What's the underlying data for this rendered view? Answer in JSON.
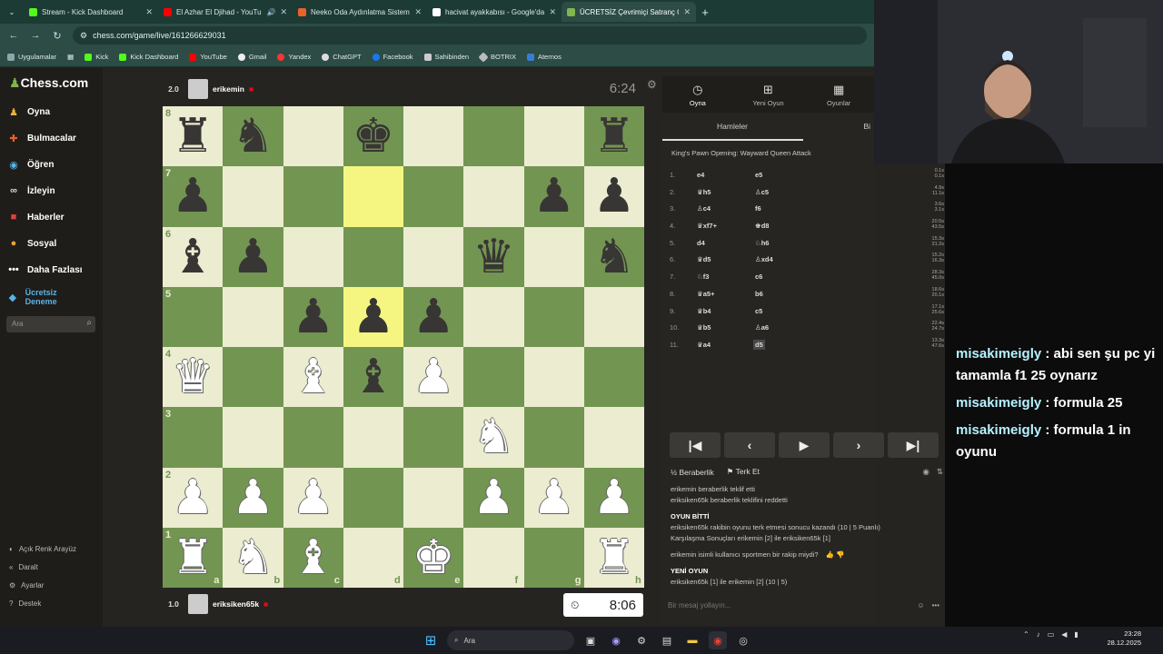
{
  "browser": {
    "tabs": [
      {
        "title": "Stream - Kick Dashboard",
        "color": "#53fc18"
      },
      {
        "title": "El Azhar El Djihad - YouTube",
        "color": "#ff0000"
      },
      {
        "title": "Neeko Oda Aydınlatma Sistem",
        "color": "#e8632b"
      },
      {
        "title": "hacivat ayakkabısı - Google'da",
        "color": "#ffffff"
      },
      {
        "title": "ÜCRETSİZ Çevrimiçi Satranç Oy",
        "color": "#81b64c"
      }
    ],
    "url": "chess.com/game/live/161266629031",
    "bookmarks": [
      "Uygulamalar",
      "Kick",
      "Kick Dashboard",
      "YouTube",
      "Gmail",
      "Yandex",
      "ChatGPT",
      "Facebook",
      "Sahibinden",
      "BOTRIX",
      "Aternos"
    ]
  },
  "sidebar": {
    "logo": "Chess.com",
    "items": [
      "Oyna",
      "Bulmacalar",
      "Öğren",
      "İzleyin",
      "Haberler",
      "Sosyal",
      "Daha Fazlası"
    ],
    "promo": "Ücretsiz Deneme",
    "search_placeholder": "Ara",
    "footer": [
      "Açık Renk Arayüz",
      "Daralt",
      "Ayarlar",
      "Destek"
    ]
  },
  "game": {
    "top_player": {
      "name": "erikemin",
      "score": "2.0",
      "clock": "6:24"
    },
    "bottom_player": {
      "name": "eriksiken65k",
      "score": "1.0",
      "clock": "8:06"
    },
    "board": [
      [
        "r",
        "n",
        "",
        "k",
        "",
        "",
        "",
        "r"
      ],
      [
        "p",
        "",
        "",
        "",
        "",
        "",
        "p",
        "p"
      ],
      [
        "b",
        "p",
        "",
        "",
        "",
        "q",
        "",
        "n"
      ],
      [
        "",
        "",
        "p",
        "p",
        "p",
        "",
        "",
        ""
      ],
      [
        "Q",
        "",
        "B",
        "b",
        "P",
        "",
        "",
        ""
      ],
      [
        "",
        "",
        "",
        "",
        "",
        "N",
        "",
        ""
      ],
      [
        "P",
        "P",
        "P",
        "",
        "",
        "P",
        "P",
        "P"
      ],
      [
        "R",
        "N",
        "B",
        "",
        "K",
        "",
        "",
        "R"
      ]
    ],
    "highlights": [
      "d7",
      "d5"
    ]
  },
  "panel": {
    "tabs": [
      "Oyna",
      "Yeni Oyun",
      "Oyunlar"
    ],
    "moves_tab": "Hamleler",
    "moves_tab2": "Bi",
    "opening": "King's Pawn Opening: Wayward Queen Attack",
    "moves": [
      {
        "n": "1.",
        "w": "e4",
        "b": "e5",
        "wt": "0.1s",
        "bt": "0.1s"
      },
      {
        "n": "2.",
        "w": "♛h5",
        "b": "♙c5",
        "wt": "4.9s",
        "bt": "11.1s"
      },
      {
        "n": "3.",
        "w": "♙c4",
        "b": "f6",
        "wt": "3.6s",
        "bt": "3.1s"
      },
      {
        "n": "4.",
        "w": "♛xf7+",
        "b": "♚d8",
        "wt": "20.5s",
        "bt": "43.5s"
      },
      {
        "n": "5.",
        "w": "d4",
        "b": "♘h6",
        "wt": "15.3s",
        "bt": "31.2s"
      },
      {
        "n": "6.",
        "w": "♛d5",
        "b": "♙xd4",
        "wt": "15.2s",
        "bt": "16.3s"
      },
      {
        "n": "7.",
        "w": "♘f3",
        "b": "c6",
        "wt": "28.3s",
        "bt": "45.0s"
      },
      {
        "n": "8.",
        "w": "♛a5+",
        "b": "b6",
        "wt": "18.6s",
        "bt": "20.1s"
      },
      {
        "n": "9.",
        "w": "♛b4",
        "b": "c5",
        "wt": "17.1s",
        "bt": "25.6s"
      },
      {
        "n": "10.",
        "w": "♛b5",
        "b": "♙a6",
        "wt": "22.4s",
        "bt": "24.7s"
      },
      {
        "n": "11.",
        "w": "♛a4",
        "b": "d5",
        "wt": "13.3s",
        "bt": "47.6s"
      }
    ],
    "draw": "Beraberlik",
    "resign": "Terk Et",
    "chat": {
      "l1": "erikemin beraberlik teklif etti",
      "l2": "eriksiken65k beraberlik teklifini reddetti",
      "l3": "OYUN BİTTİ",
      "l4": "eriksiken65k rakibin oyunu terk etmesi sonucu kazandı (10 | 5 Puanlı)",
      "l5": "Karşılaşma Sonuçları erikemin [2] ile eriksiken65k [1]",
      "l6": "erikemin isimli kullanıcı sportmen bir rakip miydi?",
      "l7": "YENİ OYUN",
      "l8": "eriksiken65k [1] ile erikemin [2] (10 | 5)"
    },
    "chat_placeholder": "Bir mesaj yollayın..."
  },
  "stream_chat": [
    {
      "user": "misakimeigly",
      "text": ": abi sen şu pc yi tamamla f1 25 oynarız"
    },
    {
      "user": "misakimeigly",
      "text": ": formula 25"
    },
    {
      "user": "misakimeigly",
      "text": ": formula 1 in oyunu"
    }
  ],
  "taskbar": {
    "search": "Ara",
    "time": "23:28",
    "date": "28.12.2025"
  }
}
